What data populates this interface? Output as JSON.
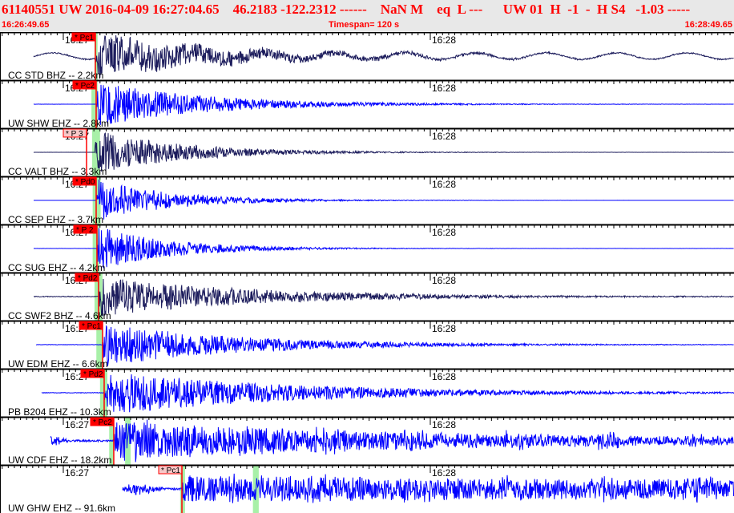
{
  "header": {
    "title": "61140551 UW 2016-04-09 16:27:04.65    46.2183 -122.2312 ------    NaN M    eq  L ---      UW 01  H  -1  -  H S4   -1.03 -----",
    "start_time": "16:26:49.65",
    "timespan": "Timespan= 120 s",
    "end_time": "16:28:49.65"
  },
  "axis": {
    "start": "16:26:49.65",
    "span_s": 120,
    "minute_labels": [
      "16:27",
      "16:28"
    ]
  },
  "colors": {
    "text": "#ff0000",
    "pick": "#ff0000",
    "pick_light": "#f8c8c8",
    "band": "#a8f0a8",
    "trace_dark": "#1c1c5c",
    "trace_blue": "#0000ff",
    "header_bg": "#e8e8e8"
  },
  "channels": [
    {
      "label": "CC STD BHZ -- 2.2km",
      "pick": "* Pc1",
      "pick_time": "16:27:05.24",
      "pick_style": "solid",
      "bands": [
        [
          "16:27:05.10",
          "16:27:05.60"
        ]
      ],
      "color": "dark",
      "start": "16:26:55.15",
      "onset": "16:27:05.3",
      "amp": 1.0,
      "noise": 0.2,
      "decay": 20
    },
    {
      "label": "UW SHW EHZ -- 2.8km",
      "pick": "* Pc2",
      "pick_time": "16:27:05.37",
      "pick_style": "solid",
      "bands": [
        [
          "16:27:04.60",
          "16:27:05.60"
        ]
      ],
      "color": "blue",
      "start": "16:26:55.15",
      "onset": "16:27:05.4",
      "amp": 1.0,
      "noise": 0.02,
      "decay": 18
    },
    {
      "label": "CC VALT BHZ -- 3.3km",
      "pick": "* P 3",
      "pick_time": "16:27:03.80",
      "pick_style": "light",
      "bands": [
        [
          "16:27:04.70",
          "16:27:06.00"
        ]
      ],
      "color": "dark",
      "start": "16:26:55.15",
      "onset": "16:27:05.2",
      "amp": 1.0,
      "noise": 0.02,
      "decay": 14
    },
    {
      "label": "CC SEP EHZ -- 3.7km",
      "pick": "* Pd0",
      "pick_time": "16:27:05.37",
      "pick_style": "solid",
      "bands": [
        [
          "16:27:04.80",
          "16:27:06.10"
        ]
      ],
      "color": "blue",
      "start": "16:26:55.15",
      "onset": "16:27:05.4",
      "amp": 1.0,
      "noise": 0.01,
      "decay": 12
    },
    {
      "label": "CC SUG EHZ -- 4.2km",
      "pick": "* P 2",
      "pick_time": "16:27:05.50",
      "pick_style": "solid",
      "bands": [
        [
          "16:27:04.80",
          "16:27:05.90"
        ]
      ],
      "color": "blue",
      "start": "16:26:55.15",
      "onset": "16:27:05.5",
      "amp": 1.0,
      "noise": 0.02,
      "decay": 12
    },
    {
      "label": "CC SWF2 BHZ -- 4.6km",
      "pick": "* Pd2",
      "pick_time": "16:27:05.76",
      "pick_style": "solid",
      "bands": [
        [
          "16:27:05.10",
          "16:27:06.40"
        ]
      ],
      "color": "dark",
      "start": "16:26:55.15",
      "onset": "16:27:05.8",
      "amp": 0.9,
      "noise": 0.12,
      "decay": 25
    },
    {
      "label": "UW EDM EHZ -- 6.6km",
      "pick": "* Pc1",
      "pick_time": "16:27:06.42",
      "pick_style": "solid",
      "bands": [
        [
          "16:27:05.40",
          "16:27:06.40"
        ]
      ],
      "color": "blue",
      "start": "16:26:55.55",
      "onset": "16:27:06.4",
      "amp": 1.0,
      "noise": 0.06,
      "decay": 22
    },
    {
      "label": "PB B204 EHZ -- 10.3km",
      "pick": "* Pd2",
      "pick_time": "16:27:06.68",
      "pick_style": "solid",
      "bands": [
        [
          "16:27:06.00",
          "16:27:07.20"
        ]
      ],
      "color": "blue",
      "start": "16:26:56.45",
      "onset": "16:27:06.7",
      "amp": 1.0,
      "noise": 0.09,
      "decay": 30
    },
    {
      "label": "UW CDF EHZ -- 18.2km",
      "pick": "* Pc2",
      "pick_time": "16:27:08.25",
      "pick_style": "solid",
      "bands": [
        [
          "16:27:07.50",
          "16:27:08.30"
        ],
        [
          "16:27:10.10",
          "16:27:11.00"
        ]
      ],
      "color": "blue",
      "start": "16:26:57.90",
      "onset": "16:27:08.3",
      "amp": 0.85,
      "noise": 0.3,
      "decay": 60
    },
    {
      "label": "UW GHW EHZ -- 91.6km",
      "pick": "* Pc1",
      "pick_time": "16:27:19.39",
      "pick_style": "light",
      "bands": [
        [
          "16:27:19.10",
          "16:27:19.90"
        ],
        [
          "16:27:31.00",
          "16:27:31.95"
        ]
      ],
      "color": "blue",
      "start": "16:27:09.70",
      "onset": "16:27:19.4",
      "amp": 0.6,
      "noise": 0.35,
      "decay": 200
    }
  ]
}
